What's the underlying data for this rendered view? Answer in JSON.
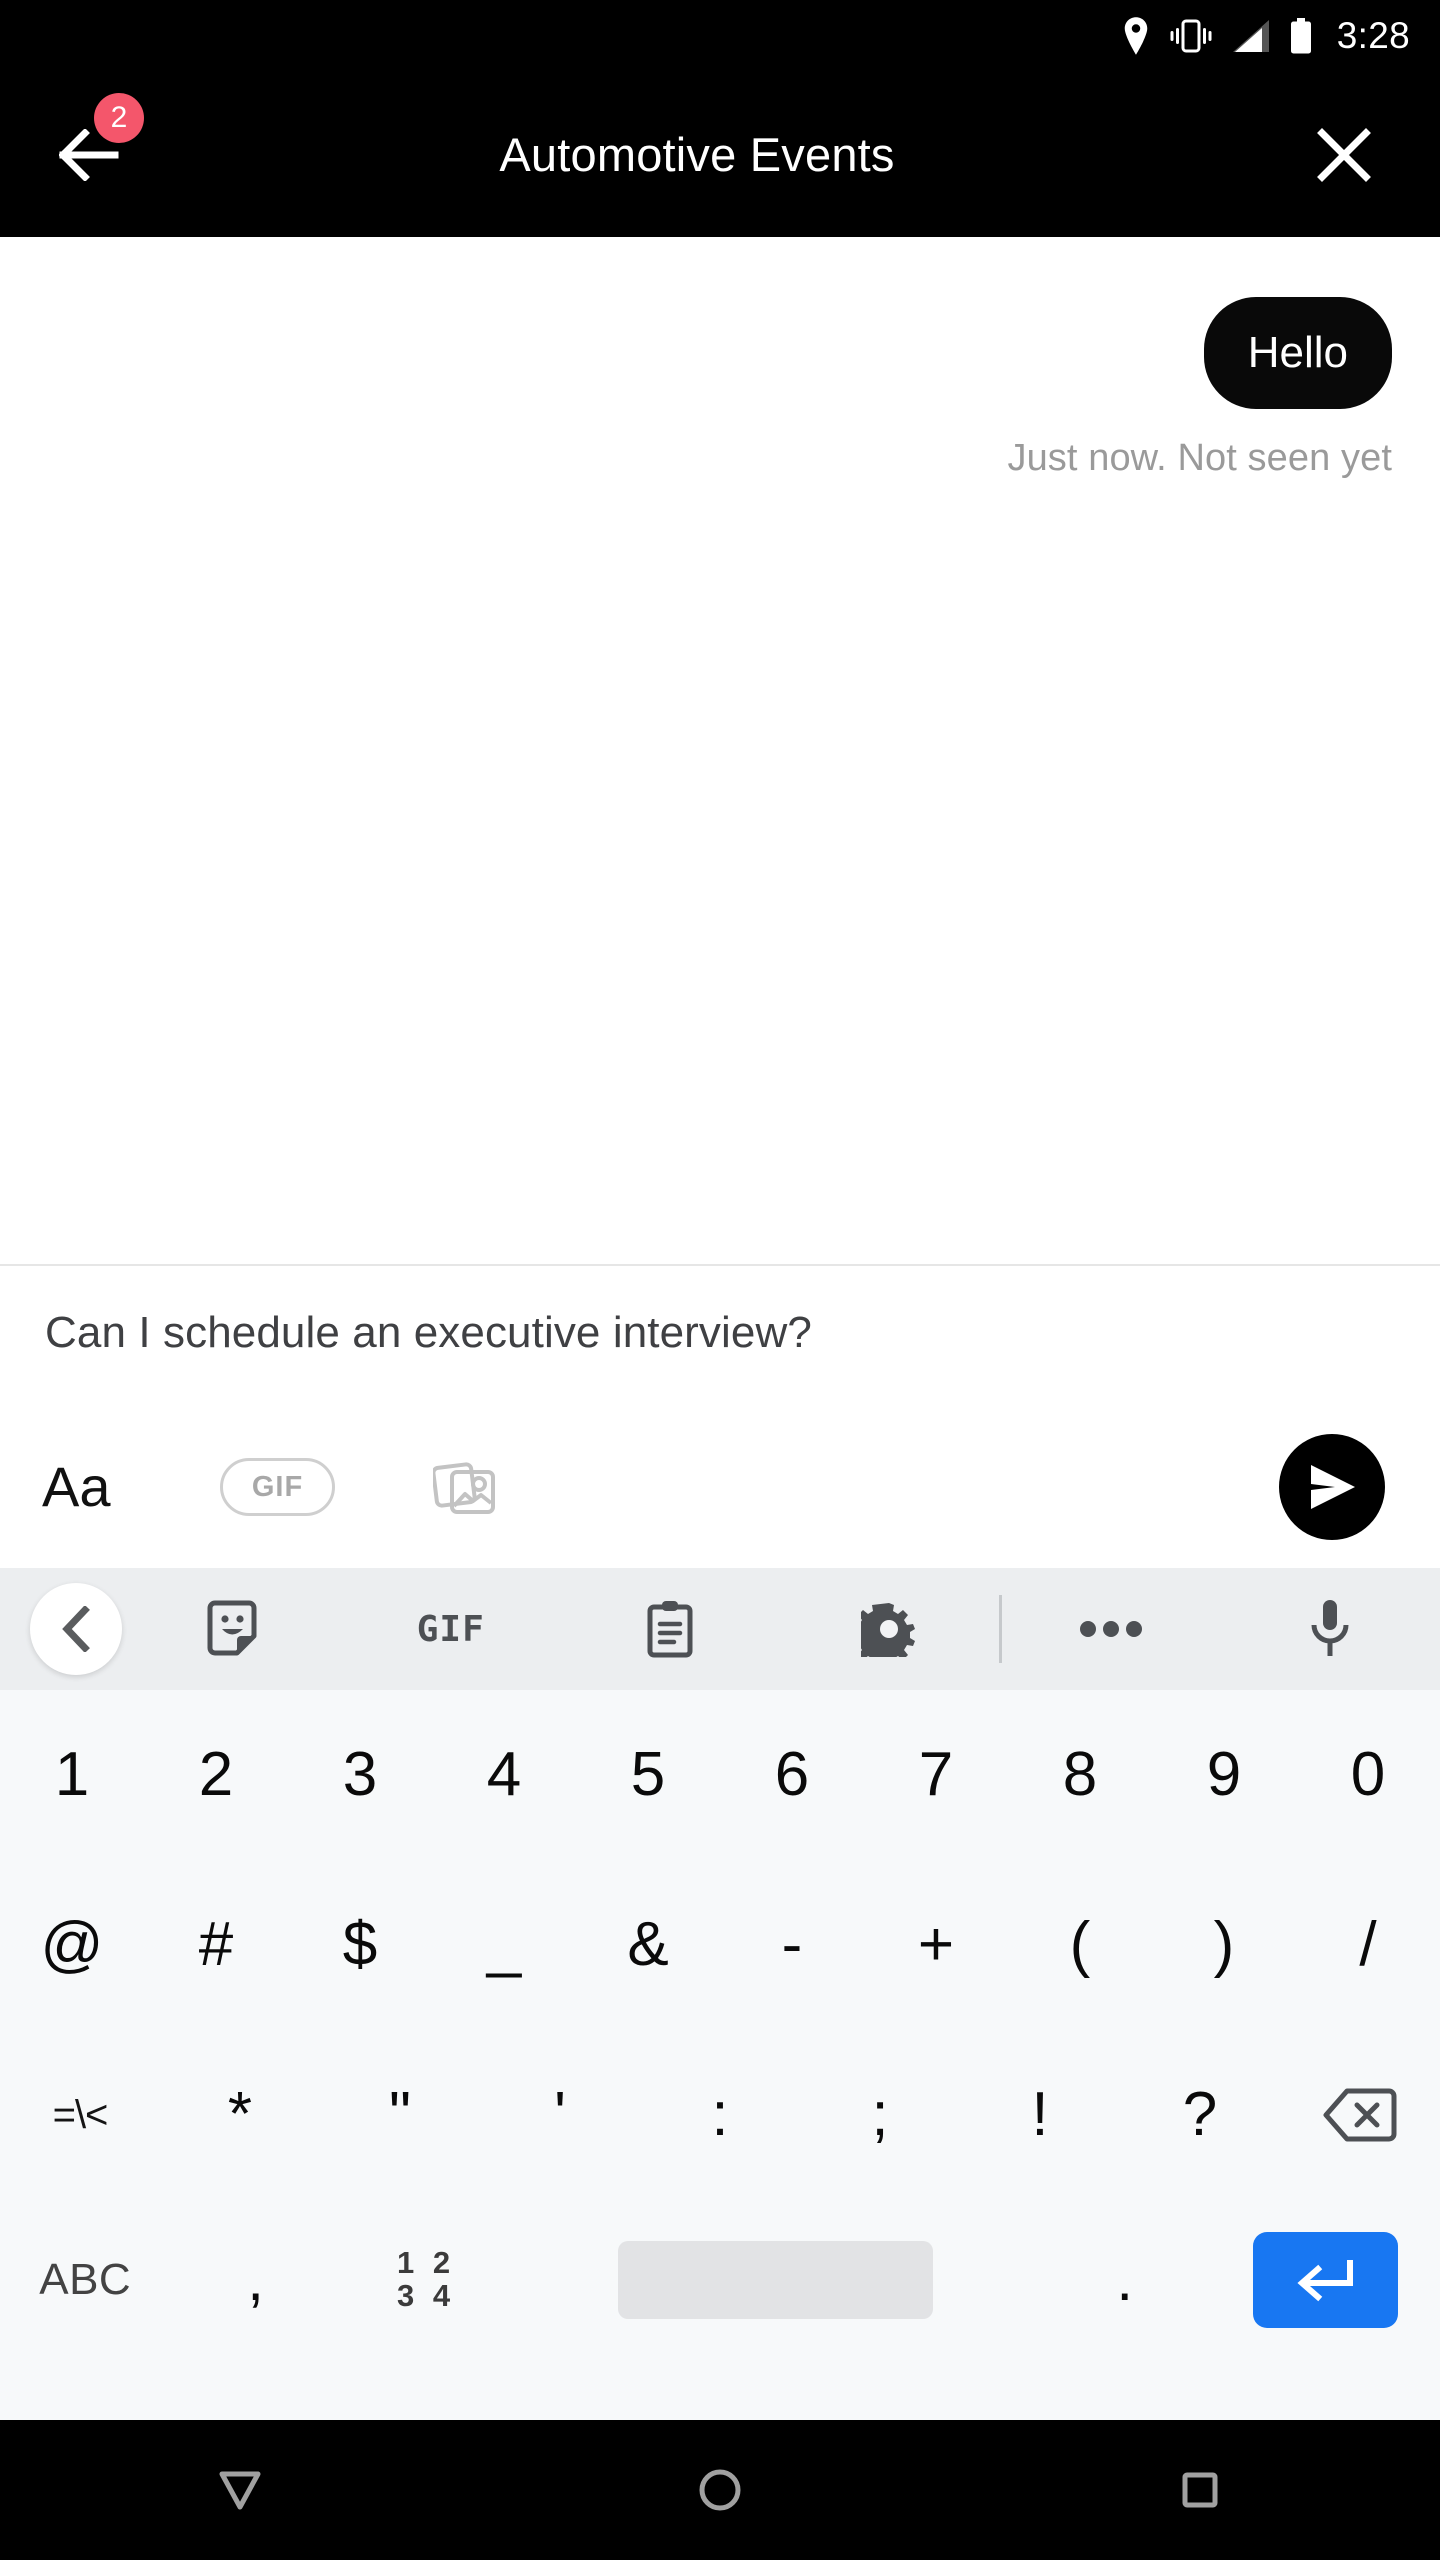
{
  "status_bar": {
    "time": "3:28",
    "icons": [
      "location-pin-icon",
      "vibrate-icon",
      "signal-icon",
      "battery-icon"
    ]
  },
  "app_bar": {
    "title": "Automotive Events",
    "back_badge_count": "2",
    "back_icon": "arrow-left-icon",
    "close_icon": "close-icon"
  },
  "thread": {
    "messages": [
      {
        "text": "Hello",
        "side": "outgoing"
      }
    ],
    "status": "Just now. Not seen yet"
  },
  "composer": {
    "input_value": "Can I schedule an executive interview?",
    "input_placeholder": "Aa",
    "format_label": "Aa",
    "gif_label": "GIF",
    "gallery_icon": "image-gallery-icon",
    "send_icon": "send-icon"
  },
  "keyboard": {
    "toolbar": [
      {
        "name": "toolbar-back",
        "icon": "chevron-left-icon",
        "label": ""
      },
      {
        "name": "toolbar-sticker",
        "icon": "sticker-icon",
        "label": ""
      },
      {
        "name": "toolbar-gif",
        "icon": "gif-text",
        "label": "GIF"
      },
      {
        "name": "toolbar-clipboard",
        "icon": "clipboard-icon",
        "label": ""
      },
      {
        "name": "toolbar-settings",
        "icon": "gear-icon",
        "label": ""
      },
      {
        "name": "toolbar-more",
        "icon": "more-horizontal-icon",
        "label": ""
      },
      {
        "name": "toolbar-mic",
        "icon": "microphone-icon",
        "label": ""
      }
    ],
    "row1": [
      "1",
      "2",
      "3",
      "4",
      "5",
      "6",
      "7",
      "8",
      "9",
      "0"
    ],
    "row2": [
      "@",
      "#",
      "$",
      "_",
      "&",
      "-",
      "+",
      "(",
      ")",
      "/"
    ],
    "row3": {
      "symbol_switch": "=\\<",
      "keys": [
        "*",
        "\"",
        "'",
        ":",
        ";",
        "!",
        "?"
      ],
      "backspace_icon": "backspace-icon"
    },
    "row4": {
      "abc": "ABC",
      "comma": ",",
      "numpad_top": "1 2",
      "numpad_bottom": "3 4",
      "space": "",
      "period": ".",
      "enter_icon": "enter-icon"
    }
  },
  "nav_bar": {
    "back_icon": "nav-back-triangle-icon",
    "home_icon": "nav-home-circle-icon",
    "recents_icon": "nav-recents-square-icon"
  },
  "colors": {
    "app_bar_bg": "#000000",
    "bubble_bg": "#090909",
    "badge": "#f4566b",
    "enter_key": "#1877f2",
    "keyboard_bg": "#f7f9fa",
    "keyboard_toolbar_bg": "#eceef0"
  }
}
